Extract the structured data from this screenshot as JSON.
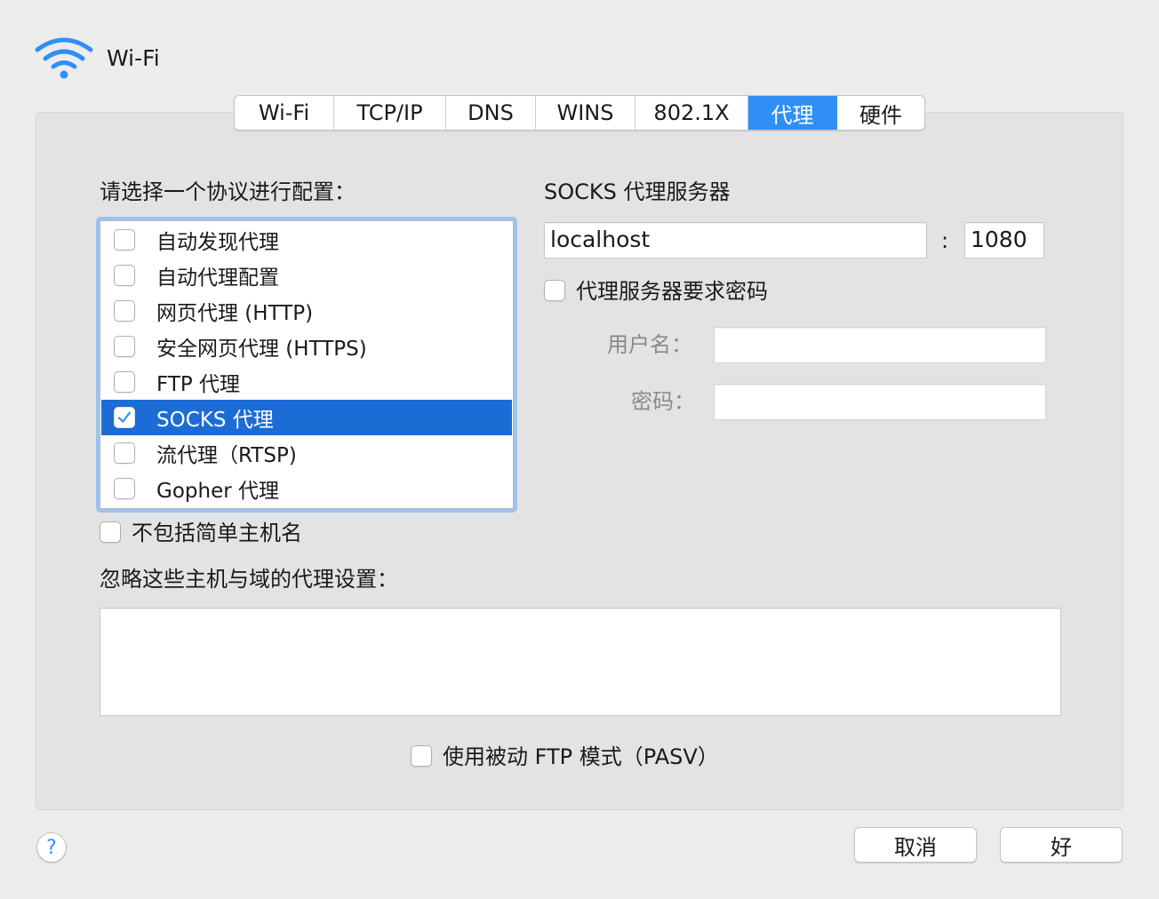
{
  "window": {
    "title": "Wi-Fi",
    "icon": "wifi-icon"
  },
  "tabs": [
    {
      "label": "Wi-Fi"
    },
    {
      "label": "TCP/IP"
    },
    {
      "label": "DNS"
    },
    {
      "label": "WINS"
    },
    {
      "label": "802.1X"
    },
    {
      "label": "代理",
      "active": true
    },
    {
      "label": "硬件"
    }
  ],
  "protocols": {
    "heading": "请选择一个协议进行配置：",
    "items": [
      {
        "label": "自动发现代理",
        "checked": false
      },
      {
        "label": "自动代理配置",
        "checked": false
      },
      {
        "label": "网页代理 (HTTP)",
        "checked": false
      },
      {
        "label": "安全网页代理 (HTTPS)",
        "checked": false
      },
      {
        "label": "FTP 代理",
        "checked": false
      },
      {
        "label": "SOCKS 代理",
        "checked": true,
        "selected": true
      },
      {
        "label": "流代理（RTSP)",
        "checked": false
      },
      {
        "label": "Gopher 代理",
        "checked": false
      }
    ]
  },
  "server": {
    "heading": "SOCKS 代理服务器",
    "host": "localhost",
    "separator": ":",
    "port": "1080",
    "require_password_label": "代理服务器要求密码",
    "username_label": "用户名：",
    "username_value": "",
    "password_label": "密码：",
    "password_value": ""
  },
  "exclude_simple_hostnames_label": "不包括简单主机名",
  "bypass": {
    "label": "忽略这些主机与域的代理设置：",
    "value": ""
  },
  "pasv_label": "使用被动 FTP 模式（PASV）",
  "buttons": {
    "help": "?",
    "cancel": "取消",
    "ok": "好"
  },
  "colors": {
    "accent": "#2f8ff6",
    "selection": "#1c6cd6"
  }
}
